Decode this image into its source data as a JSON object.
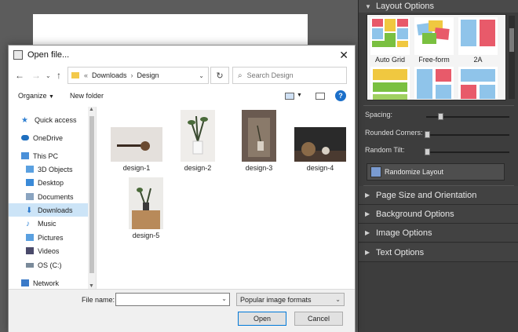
{
  "dialog": {
    "title": "Open file...",
    "address": {
      "prefix": "«",
      "path": [
        "Downloads",
        "Design"
      ],
      "separator": "›"
    },
    "search_placeholder": "Search Design",
    "toolbar": {
      "organize": "Organize",
      "new_folder": "New folder",
      "help": "?"
    },
    "nav": [
      {
        "label": "Quick access",
        "icon": "star-icon",
        "color": "#2f7fd1"
      },
      {
        "label": "OneDrive",
        "icon": "cloud-icon",
        "color": "#1f6fbf"
      },
      {
        "label": "This PC",
        "icon": "computer-icon",
        "color": "#4a90d9"
      },
      {
        "label": "3D Objects",
        "icon": "cube-icon",
        "color": "#5aa0e0"
      },
      {
        "label": "Desktop",
        "icon": "desktop-icon",
        "color": "#3a8ad8"
      },
      {
        "label": "Documents",
        "icon": "document-icon",
        "color": "#8aa4c0"
      },
      {
        "label": "Downloads",
        "icon": "download-icon",
        "color": "#2a78cc"
      },
      {
        "label": "Music",
        "icon": "music-icon",
        "color": "#3a8ad8"
      },
      {
        "label": "Pictures",
        "icon": "picture-icon",
        "color": "#5aa0e0"
      },
      {
        "label": "Videos",
        "icon": "video-icon",
        "color": "#4a4a6a"
      },
      {
        "label": "OS (C:)",
        "icon": "drive-icon",
        "color": "#7a8a9a"
      },
      {
        "label": "Network",
        "icon": "network-icon",
        "color": "#3a7ac8"
      }
    ],
    "selected_nav": "Downloads",
    "files": [
      {
        "name": "design-1"
      },
      {
        "name": "design-2"
      },
      {
        "name": "design-3"
      },
      {
        "name": "design-4"
      },
      {
        "name": "design-5"
      }
    ],
    "file_name_label": "File name:",
    "file_name_value": "",
    "file_type": "Popular image formats",
    "open_label": "Open",
    "cancel_label": "Cancel"
  },
  "panel": {
    "layout_options": "Layout Options",
    "layouts": [
      "Auto Grid",
      "Free-form",
      "2A"
    ],
    "spacing_label": "Spacing:",
    "spacing_value": 0.1,
    "rounded_label": "Rounded Corners:",
    "rounded_value": 0.0,
    "tilt_label": "Random Tilt:",
    "tilt_value": 0.0,
    "randomize_label": "Randomize Layout",
    "sections": [
      "Page Size and Orientation",
      "Background Options",
      "Image Options",
      "Text Options"
    ]
  },
  "colors": {
    "accent": "#0078d7",
    "panel_bg": "#3d3d3d",
    "selection": "#cce4f7"
  }
}
